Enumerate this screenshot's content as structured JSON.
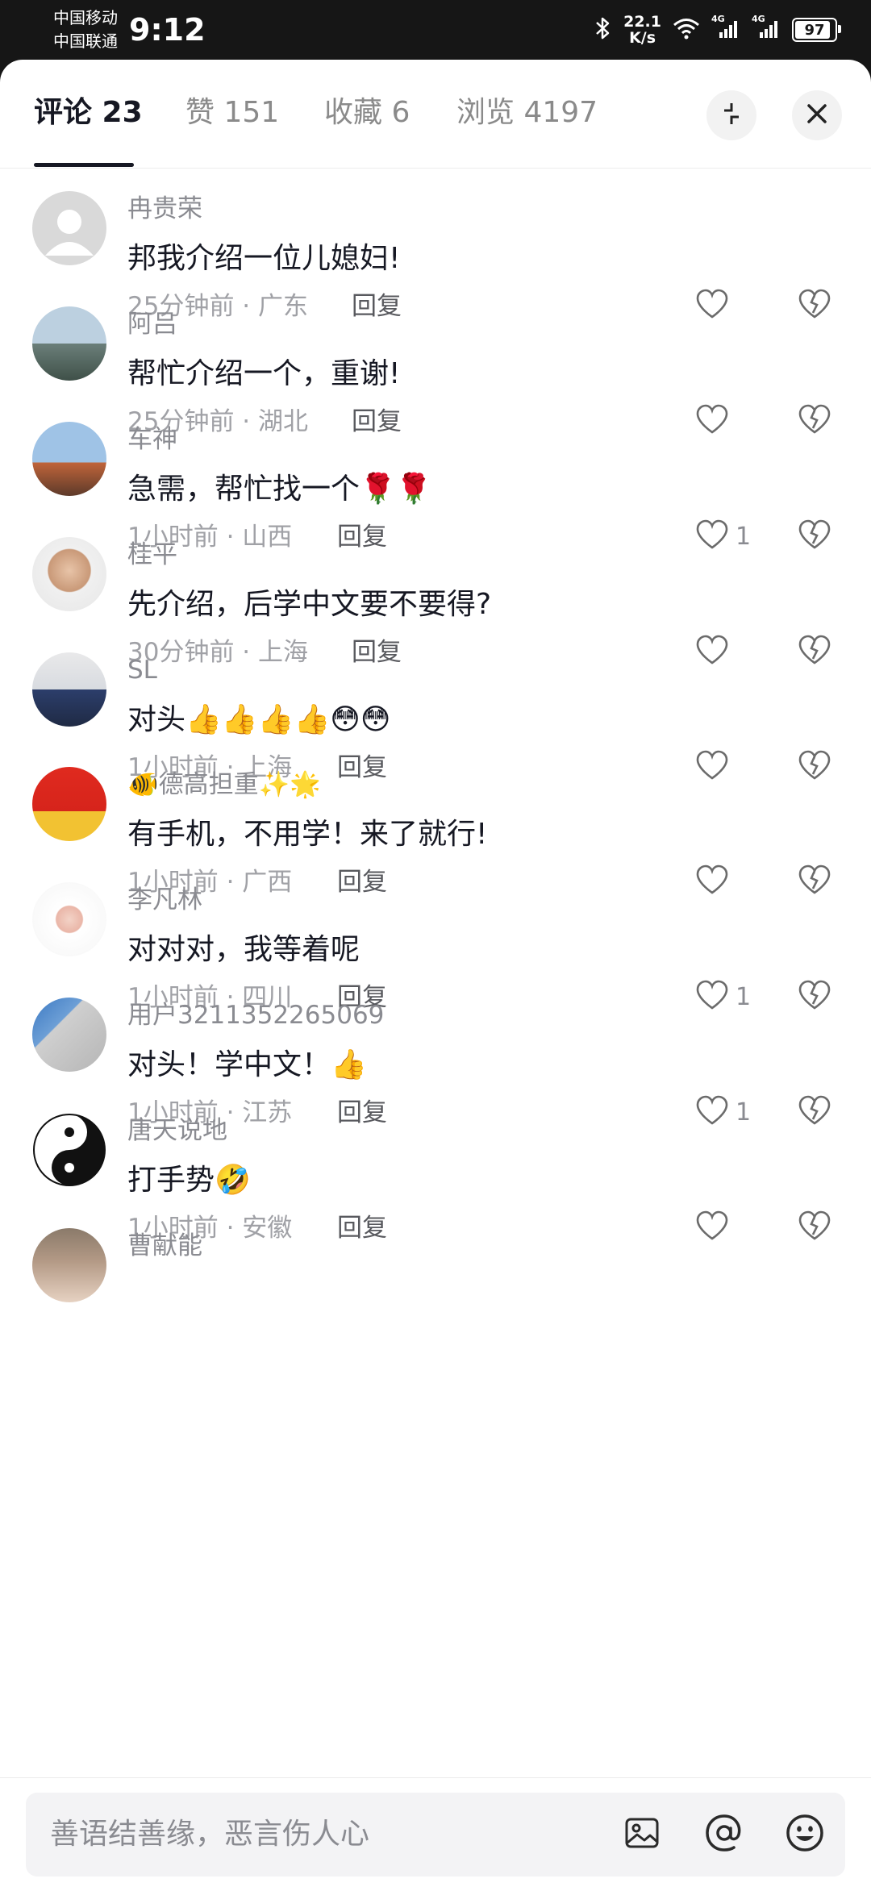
{
  "status_bar": {
    "carrier_1": "中国移动",
    "carrier_2": "中国联通",
    "time": "9:12",
    "net_speed_value": "22.1",
    "net_speed_unit": "K/s",
    "net_1": "4G",
    "net_2": "4G",
    "battery": "97",
    "battery_level": 0.97
  },
  "tabs": [
    {
      "label": "评论 23",
      "active": true
    },
    {
      "label": "赞 151",
      "active": false
    },
    {
      "label": "收藏 6",
      "active": false
    },
    {
      "label": "浏览 4197",
      "active": false
    }
  ],
  "reply_label": "回复",
  "comments": [
    {
      "user": "冉贵荣",
      "text": "邦我介绍一位儿媳妇!",
      "time": "25分钟前",
      "location": "广东",
      "likes": ""
    },
    {
      "user": "阿吕",
      "text": "帮忙介绍一个，重谢!",
      "time": "25分钟前",
      "location": "湖北",
      "likes": ""
    },
    {
      "user": "车神",
      "text": "急需，帮忙找一个🌹🌹",
      "time": "1小时前",
      "location": "山西",
      "likes": "1"
    },
    {
      "user": "桂平",
      "text": "先介绍，后学中文要不要得?",
      "time": "30分钟前",
      "location": "上海",
      "likes": ""
    },
    {
      "user": "SL",
      "text": "对头👍👍👍👍😳😳",
      "time": "1小时前",
      "location": "上海",
      "likes": ""
    },
    {
      "user": "🐠德高担重✨🌟",
      "text": "有手机，不用学！来了就行!",
      "time": "1小时前",
      "location": "广西",
      "likes": ""
    },
    {
      "user": "李凡林",
      "text": "对对对，我等着呢",
      "time": "1小时前",
      "location": "四川",
      "likes": "1"
    },
    {
      "user": "用户3211352265069",
      "text": "对头！学中文！👍",
      "time": "1小时前",
      "location": "江苏",
      "likes": "1"
    },
    {
      "user": "唐天说地",
      "text": "打手势🤣",
      "time": "1小时前",
      "location": "安徽",
      "likes": ""
    },
    {
      "user": "曹献能",
      "text": "",
      "time": "",
      "location": "",
      "likes": ""
    }
  ],
  "input": {
    "placeholder": "善语结善缘，恶言伤人心"
  },
  "colors": {
    "text_primary": "#161823",
    "text_secondary": "#8a8b91",
    "status_bar_bg": "#161616"
  }
}
